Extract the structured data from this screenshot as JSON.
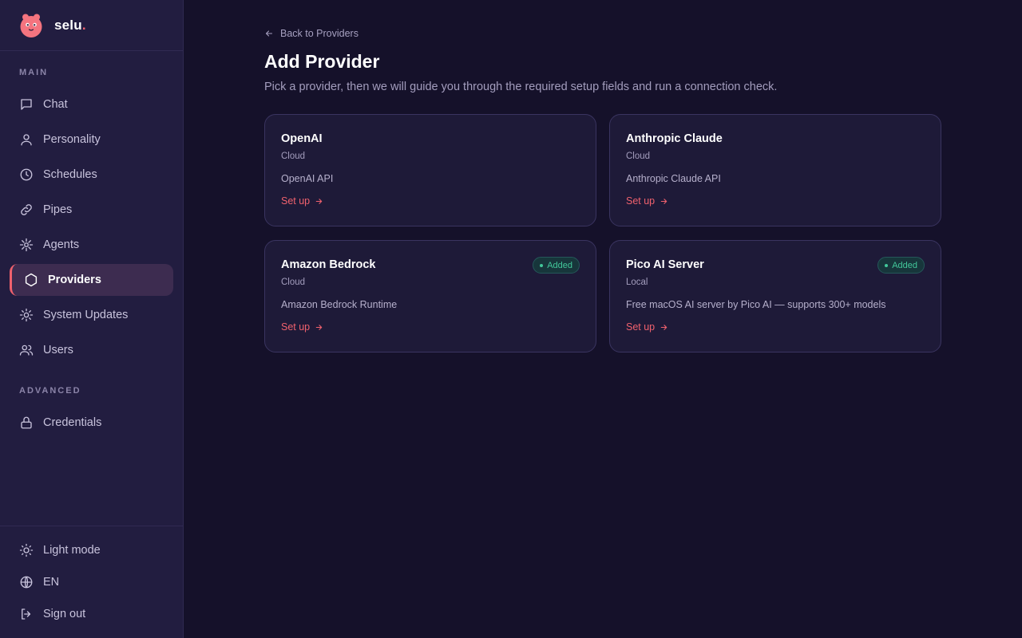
{
  "brand": {
    "name": "selu",
    "dot": "."
  },
  "sidebar": {
    "main_label": "MAIN",
    "advanced_label": "ADVANCED",
    "items": [
      {
        "label": "Chat",
        "icon": "chat-icon"
      },
      {
        "label": "Personality",
        "icon": "person-icon"
      },
      {
        "label": "Schedules",
        "icon": "clock-icon"
      },
      {
        "label": "Pipes",
        "icon": "link-icon"
      },
      {
        "label": "Agents",
        "icon": "agents-icon"
      },
      {
        "label": "Providers",
        "icon": "hexagon-icon",
        "active": true
      },
      {
        "label": "System Updates",
        "icon": "gear-icon"
      },
      {
        "label": "Users",
        "icon": "users-icon"
      }
    ],
    "advanced_items": [
      {
        "label": "Credentials",
        "icon": "lock-icon"
      }
    ],
    "bottom": [
      {
        "label": "Light mode",
        "icon": "sun-icon"
      },
      {
        "label": "EN",
        "icon": "globe-icon"
      },
      {
        "label": "Sign out",
        "icon": "sign-out-icon"
      }
    ]
  },
  "main": {
    "back_label": "Back to Providers",
    "title": "Add Provider",
    "subtitle": "Pick a provider, then we will guide you through the required setup fields and run a connection check.",
    "cards": [
      {
        "name": "OpenAI",
        "type": "Cloud",
        "desc": "OpenAI API",
        "action": "Set up",
        "badge": ""
      },
      {
        "name": "Anthropic Claude",
        "type": "Cloud",
        "desc": "Anthropic Claude API",
        "action": "Set up",
        "badge": ""
      },
      {
        "name": "Amazon Bedrock",
        "type": "Cloud",
        "desc": "Amazon Bedrock Runtime",
        "action": "Set up",
        "badge": "Added"
      },
      {
        "name": "Pico AI Server",
        "type": "Local",
        "desc": "Free macOS AI server by Pico AI — supports 300+ models",
        "action": "Set up",
        "badge": "Added"
      }
    ]
  },
  "colors": {
    "accent": "#f0616d",
    "background": "#15112a",
    "sidebar": "#221d40",
    "added_badge": "#42c79a"
  }
}
